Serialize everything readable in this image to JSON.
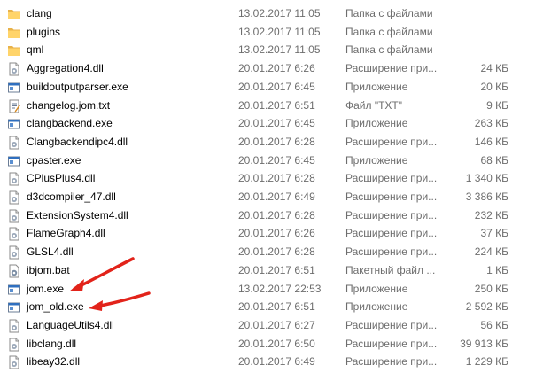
{
  "colors": {
    "folder": "#ffd46a",
    "annotation_arrow": "#e2231a"
  },
  "files": [
    {
      "name": "clang",
      "date": "13.02.2017 11:05",
      "type": "Папка с файлами",
      "size": "",
      "icon": "folder-icon"
    },
    {
      "name": "plugins",
      "date": "13.02.2017 11:05",
      "type": "Папка с файлами",
      "size": "",
      "icon": "folder-icon"
    },
    {
      "name": "qml",
      "date": "13.02.2017 11:05",
      "type": "Папка с файлами",
      "size": "",
      "icon": "folder-icon"
    },
    {
      "name": "Aggregation4.dll",
      "date": "20.01.2017 6:26",
      "type": "Расширение при...",
      "size": "24 КБ",
      "icon": "dll-icon"
    },
    {
      "name": "buildoutputparser.exe",
      "date": "20.01.2017 6:45",
      "type": "Приложение",
      "size": "20 КБ",
      "icon": "exe-icon"
    },
    {
      "name": "changelog.jom.txt",
      "date": "20.01.2017 6:51",
      "type": "Файл \"TXT\"",
      "size": "9 КБ",
      "icon": "txt-icon"
    },
    {
      "name": "clangbackend.exe",
      "date": "20.01.2017 6:45",
      "type": "Приложение",
      "size": "263 КБ",
      "icon": "exe-icon"
    },
    {
      "name": "Clangbackendipc4.dll",
      "date": "20.01.2017 6:28",
      "type": "Расширение при...",
      "size": "146 КБ",
      "icon": "dll-icon"
    },
    {
      "name": "cpaster.exe",
      "date": "20.01.2017 6:45",
      "type": "Приложение",
      "size": "68 КБ",
      "icon": "exe-icon"
    },
    {
      "name": "CPlusPlus4.dll",
      "date": "20.01.2017 6:28",
      "type": "Расширение при...",
      "size": "1 340 КБ",
      "icon": "dll-icon"
    },
    {
      "name": "d3dcompiler_47.dll",
      "date": "20.01.2017 6:49",
      "type": "Расширение при...",
      "size": "3 386 КБ",
      "icon": "dll-icon"
    },
    {
      "name": "ExtensionSystem4.dll",
      "date": "20.01.2017 6:28",
      "type": "Расширение при...",
      "size": "232 КБ",
      "icon": "dll-icon"
    },
    {
      "name": "FlameGraph4.dll",
      "date": "20.01.2017 6:26",
      "type": "Расширение при...",
      "size": "37 КБ",
      "icon": "dll-icon"
    },
    {
      "name": "GLSL4.dll",
      "date": "20.01.2017 6:28",
      "type": "Расширение при...",
      "size": "224 КБ",
      "icon": "dll-icon"
    },
    {
      "name": "ibjom.bat",
      "date": "20.01.2017 6:51",
      "type": "Пакетный файл ...",
      "size": "1 КБ",
      "icon": "bat-icon"
    },
    {
      "name": "jom.exe",
      "date": "13.02.2017 22:53",
      "type": "Приложение",
      "size": "250 КБ",
      "icon": "exe-icon"
    },
    {
      "name": "jom_old.exe",
      "date": "20.01.2017 6:51",
      "type": "Приложение",
      "size": "2 592 КБ",
      "icon": "exe-icon"
    },
    {
      "name": "LanguageUtils4.dll",
      "date": "20.01.2017 6:27",
      "type": "Расширение при...",
      "size": "56 КБ",
      "icon": "dll-icon"
    },
    {
      "name": "libclang.dll",
      "date": "20.01.2017 6:50",
      "type": "Расширение при...",
      "size": "39 913 КБ",
      "icon": "dll-icon"
    },
    {
      "name": "libeay32.dll",
      "date": "20.01.2017 6:49",
      "type": "Расширение при...",
      "size": "1 229 КБ",
      "icon": "dll-icon"
    }
  ]
}
